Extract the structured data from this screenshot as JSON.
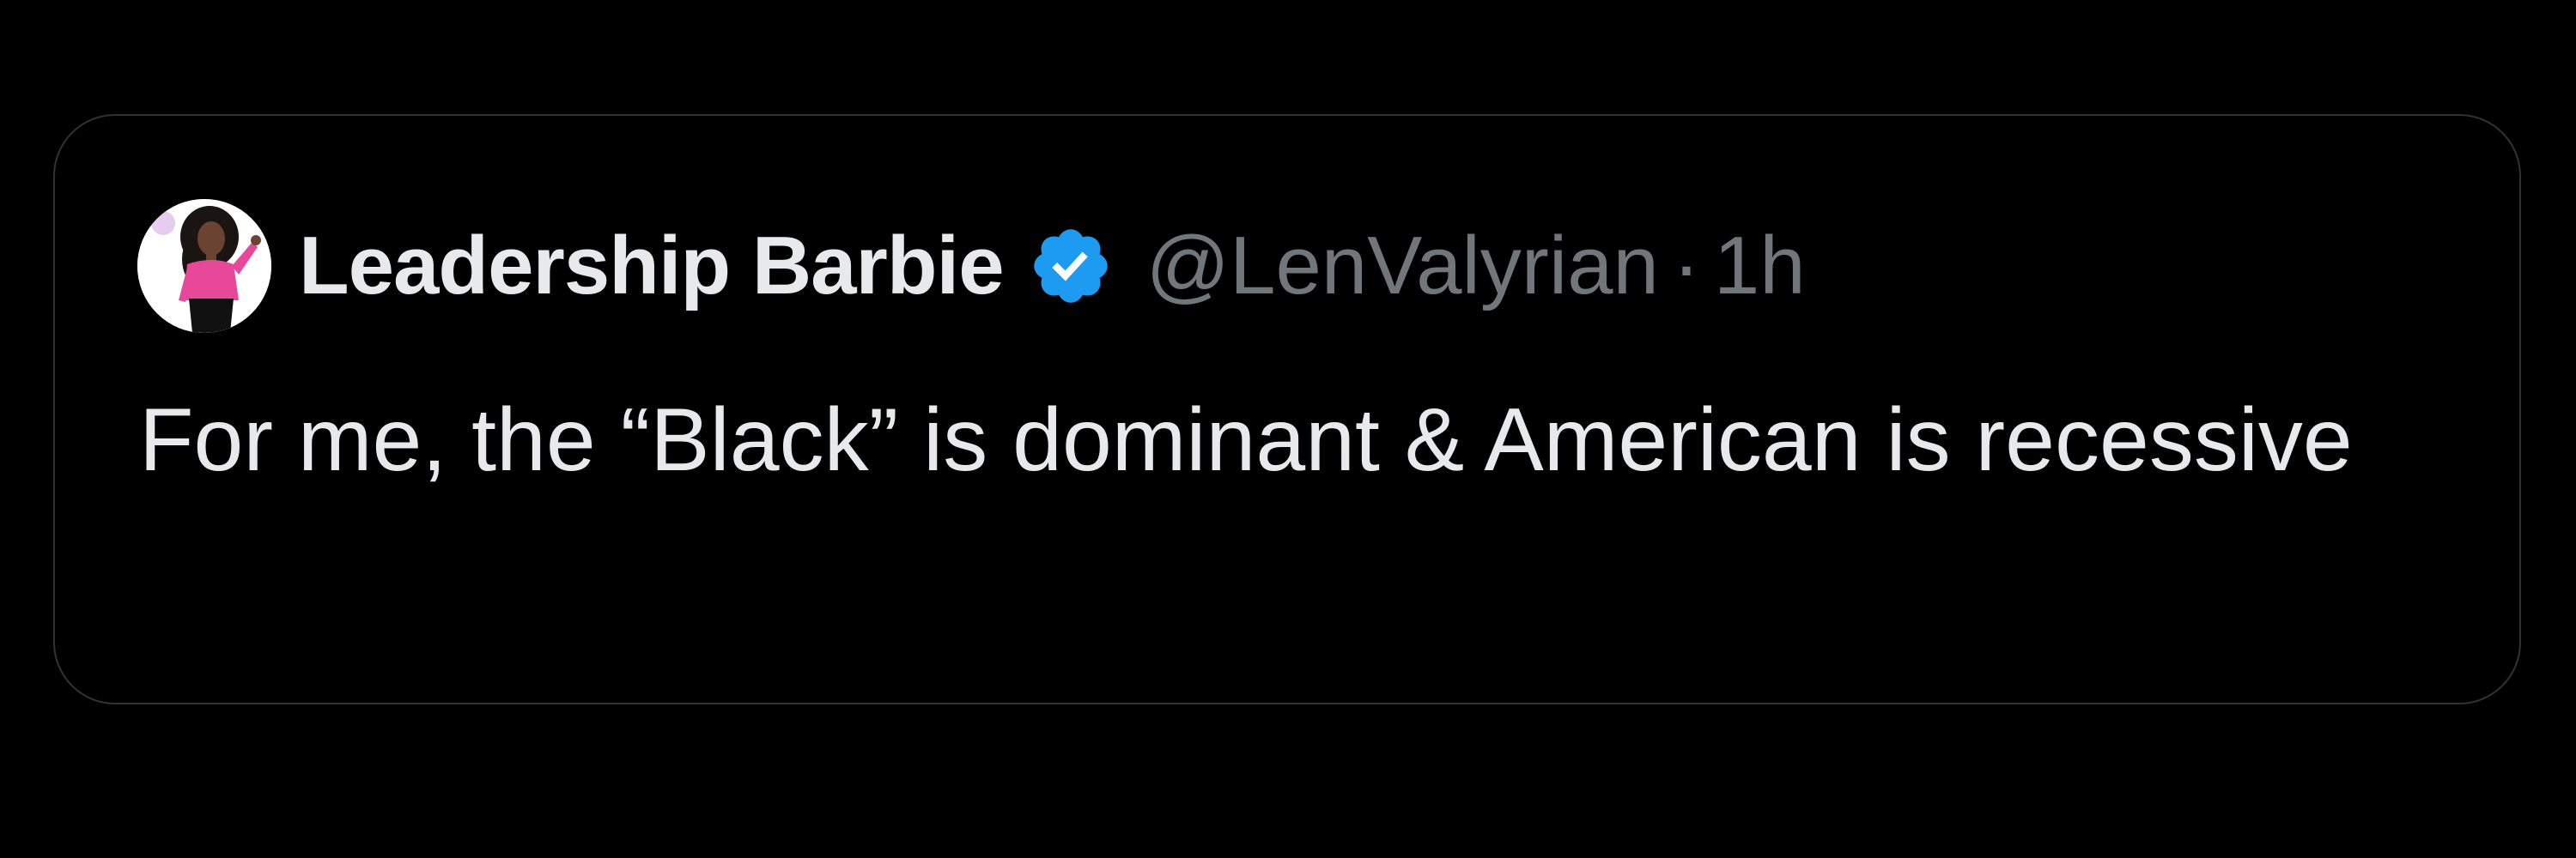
{
  "tweet": {
    "display_name": "Leadership Barbie",
    "verified": true,
    "verified_icon": "verified-badge-icon",
    "handle": "@LenValyrian",
    "separator": "·",
    "timestamp": "1h",
    "text": "For me, the “Black” is dominant & American is recessive"
  },
  "colors": {
    "background": "#000000",
    "card_border": "#2f3336",
    "primary_text": "#e7e9ea",
    "secondary_text": "#71767b",
    "verified_blue": "#1d9bf0",
    "avatar_shirt_pink": "#e8489a"
  }
}
